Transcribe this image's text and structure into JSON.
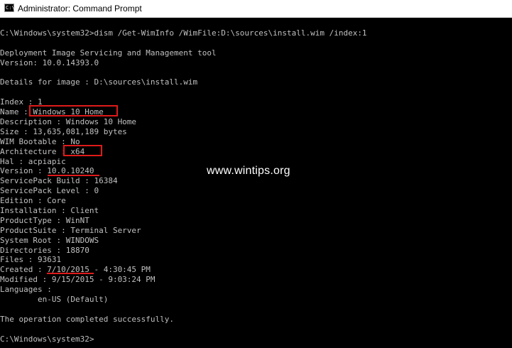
{
  "window": {
    "title": "Administrator: Command Prompt",
    "icon": "cmd-icon"
  },
  "console": {
    "lines": [
      "C:\\Windows\\system32>dism /Get-WimInfo /WimFile:D:\\sources\\install.wim /index:1",
      "",
      "Deployment Image Servicing and Management tool",
      "Version: 10.0.14393.0",
      "",
      "Details for image : D:\\sources\\install.wim",
      "",
      "Index : 1",
      "Name : Windows 10 Home",
      "Description : Windows 10 Home",
      "Size : 13,635,081,189 bytes",
      "WIM Bootable : No",
      "Architecture : x64",
      "Hal : acpiapic",
      "Version : 10.0.10240",
      "ServicePack Build : 16384",
      "ServicePack Level : 0",
      "Edition : Core",
      "Installation : Client",
      "ProductType : WinNT",
      "ProductSuite : Terminal Server",
      "System Root : WINDOWS",
      "Directories : 18870",
      "Files : 93631",
      "Created : 7/10/2015 - 4:30:45 PM",
      "Modified : 9/15/2015 - 9:03:24 PM",
      "Languages :",
      "        en-US (Default)",
      "",
      "The operation completed successfully.",
      "",
      "C:\\Windows\\system32>"
    ],
    "text_color": "#c0c0c0",
    "background": "#000000"
  },
  "annotations": {
    "watermark": "www.wintips.org",
    "highlight_color": "#e01a1a"
  }
}
